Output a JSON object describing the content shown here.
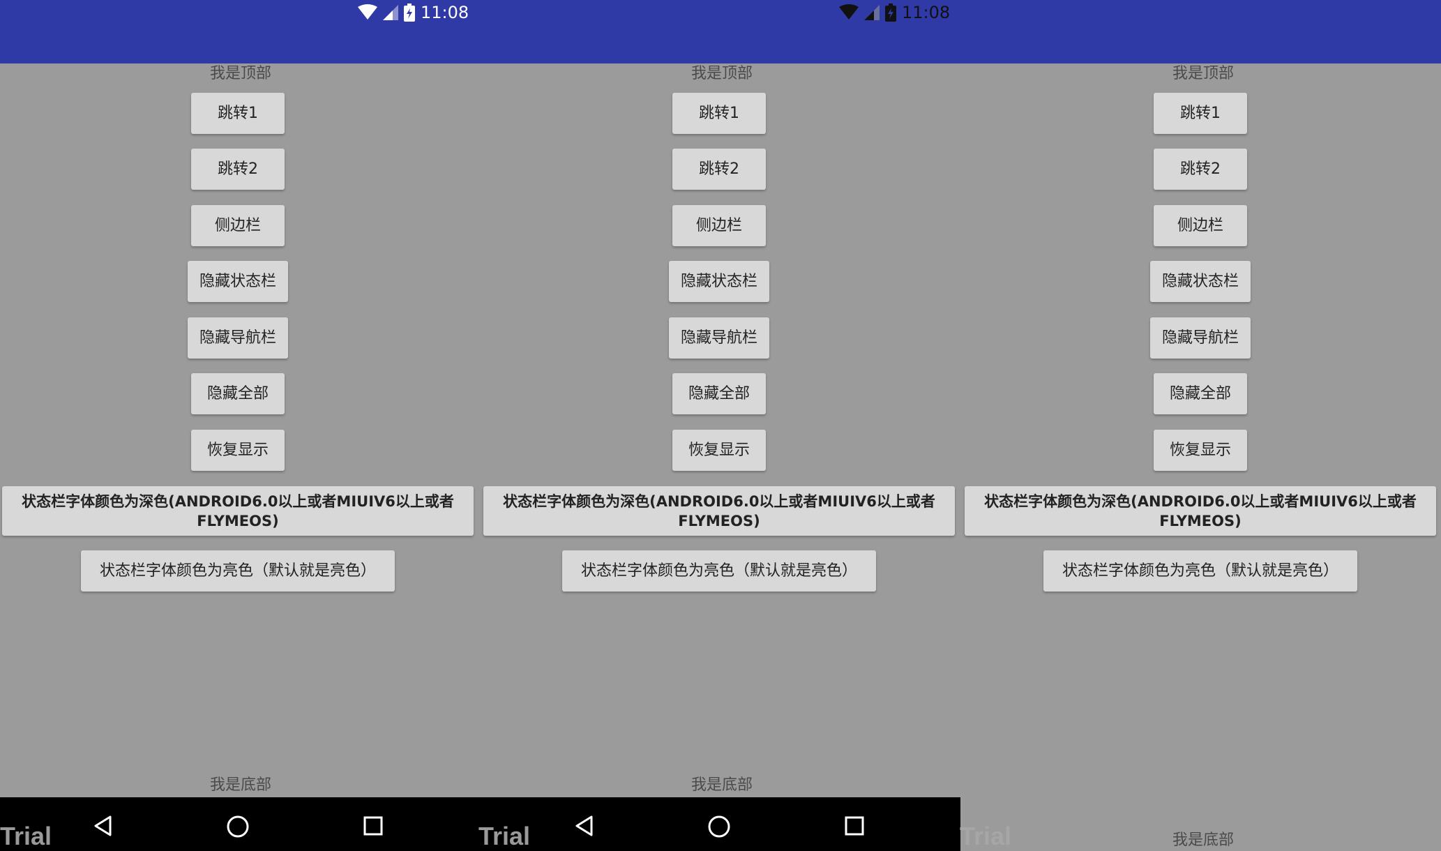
{
  "status_bar": {
    "time": "11:08",
    "color": "#303aa6",
    "icons": [
      "wifi-icon",
      "signal-icon",
      "battery-charging-icon"
    ]
  },
  "panels": [
    {
      "top_label": "我是顶部",
      "buttons": {
        "jump1": "跳转1",
        "jump2": "跳转2",
        "sidebar": "侧边栏",
        "hide_status": "隐藏状态栏",
        "hide_nav": "隐藏导航栏",
        "hide_all": "隐藏全部",
        "restore": "恢复显示",
        "dark_font": "状态栏字体颜色为深色(ANDROID6.0以上或者MIUIV6以上或者FLYMEOS)",
        "light_font": "状态栏字体颜色为亮色（默认就是亮色）"
      },
      "bottom_label": "我是底部"
    },
    {
      "top_label": "我是顶部",
      "buttons": {
        "jump1": "跳转1",
        "jump2": "跳转2",
        "sidebar": "侧边栏",
        "hide_status": "隐藏状态栏",
        "hide_nav": "隐藏导航栏",
        "hide_all": "隐藏全部",
        "restore": "恢复显示",
        "dark_font": "状态栏字体颜色为深色(ANDROID6.0以上或者MIUIV6以上或者FLYMEOS)",
        "light_font": "状态栏字体颜色为亮色（默认就是亮色）"
      },
      "bottom_label": "我是底部"
    },
    {
      "top_label": "我是顶部",
      "buttons": {
        "jump1": "跳转1",
        "jump2": "跳转2",
        "sidebar": "侧边栏",
        "hide_status": "隐藏状态栏",
        "hide_nav": "隐藏导航栏",
        "hide_all": "隐藏全部",
        "restore": "恢复显示",
        "dark_font": "状态栏字体颜色为深色(ANDROID6.0以上或者MIUIV6以上或者FLYMEOS)",
        "light_font": "状态栏字体颜色为亮色（默认就是亮色）"
      },
      "bottom_label": "我是底部"
    }
  ],
  "nav_bar": {
    "icons": [
      "back-icon",
      "home-icon",
      "recents-icon"
    ],
    "color": "#000000"
  },
  "watermark": "Trial"
}
